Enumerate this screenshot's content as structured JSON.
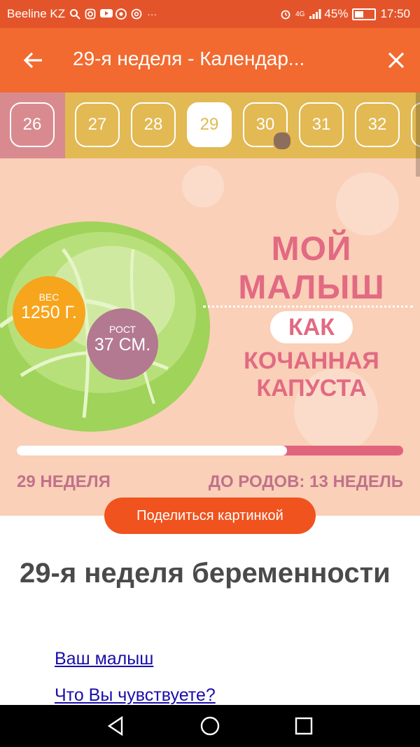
{
  "status_bar": {
    "carrier": "Beeline KZ",
    "icons_left": [
      "search-icon",
      "instagram-icon",
      "youtube-icon",
      "chrome-icon",
      "at-icon",
      "more-icon"
    ],
    "network": "4G",
    "battery": "45%",
    "time": "17:50"
  },
  "app_bar": {
    "title": "29-я неделя - Календар...",
    "back_icon": "arrow-left-icon",
    "close_icon": "close-icon"
  },
  "weeks": {
    "items": [
      "26",
      "27",
      "28",
      "29",
      "30",
      "31",
      "32"
    ],
    "active": "29"
  },
  "hero": {
    "headline": "МОЙ МАЛЫШ",
    "kak": "КАК",
    "subject": "КОЧАННАЯ КАПУСТА",
    "weight_label": "ВЕС",
    "weight_value": "1250 Г.",
    "height_label": "РОСТ",
    "height_value": "37 СМ.",
    "progress": 0.7,
    "week_label": "29 НЕДЕЛЯ",
    "till_label": "ДО РОДОВ: 13 НЕДЕЛЬ"
  },
  "share_button": "Поделиться картинкой",
  "article": {
    "title": "29-я неделя беременности",
    "links": [
      "Ваш малыш",
      "Что Вы чувствуете?"
    ]
  },
  "colors": {
    "statusbar": "#e4542a",
    "appbar": "#f26a2f",
    "weeks_bg": "#e2b953",
    "past_week_bg": "#d98a8f",
    "hero_bg": "#fad0b8",
    "accent": "#f0531e"
  }
}
